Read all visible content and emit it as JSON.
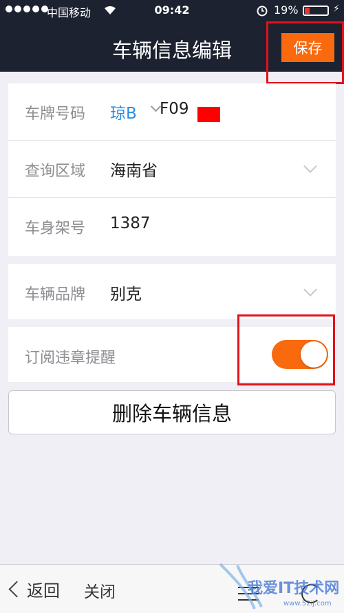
{
  "status_bar": {
    "carrier": "中国移动",
    "time": "09:42",
    "battery": "19%"
  },
  "header": {
    "title": "车辆信息编辑",
    "save_label": "保存"
  },
  "form": {
    "plate": {
      "label": "车牌号码",
      "prefix": "琼B",
      "number": "F09"
    },
    "region": {
      "label": "查询区域",
      "value": "海南省"
    },
    "frame": {
      "label": "车身架号",
      "value": "1387"
    },
    "brand": {
      "label": "车辆品牌",
      "value": "别克"
    },
    "subscribe": {
      "label": "订阅违章提醒",
      "enabled": true
    }
  },
  "delete_label": "删除车辆信息",
  "bottom_bar": {
    "back_label": "返回",
    "close_label": "关闭"
  },
  "watermark": {
    "text": "我爱IT技术网",
    "url": "www.52ij.com"
  },
  "colors": {
    "accent": "#f96a0e",
    "header_bg": "#1c2230",
    "link_blue": "#2a8de0",
    "annotation_red": "#e3101a"
  }
}
